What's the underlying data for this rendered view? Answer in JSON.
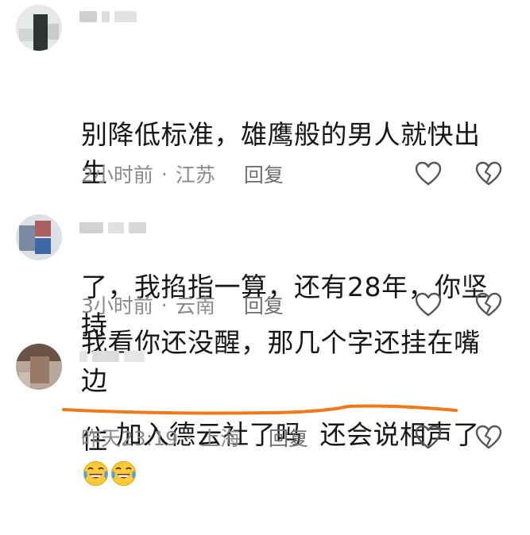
{
  "comments": [
    {
      "text": "别降低标准，雄鹰般的男人就快出生了，我掐指一算，还有28年，你坚持住",
      "lines": [
        "别降低标准，雄鹰般的男人就快出生",
        "了，我掐指一算，还有28年，你坚持",
        "住"
      ],
      "time": "2小时前",
      "location": "江苏",
      "reply": "回复"
    },
    {
      "text": "我看你还没醒，那几个字还挂在嘴边",
      "lines": [
        "我看你还没醒，那几个字还挂在嘴边"
      ],
      "time": "3小时前",
      "location": "云南",
      "reply": "回复"
    },
    {
      "text": "加入德云社了吗  还会说相声了",
      "lines": [
        "加入德云社了吗  还会说相声了"
      ],
      "time": "昨天23:19",
      "location": "上海",
      "reply": "回复",
      "emojis": [
        "laughing-crying-emoji",
        "laughing-crying-emoji"
      ]
    }
  ],
  "separator": "·",
  "icons": {
    "like": "heart-outline-icon",
    "dislike": "broken-heart-icon"
  },
  "colors": {
    "text": "#161616",
    "meta": "#8a8a8a",
    "underline": "#f07a1a",
    "icon": "#555555"
  }
}
